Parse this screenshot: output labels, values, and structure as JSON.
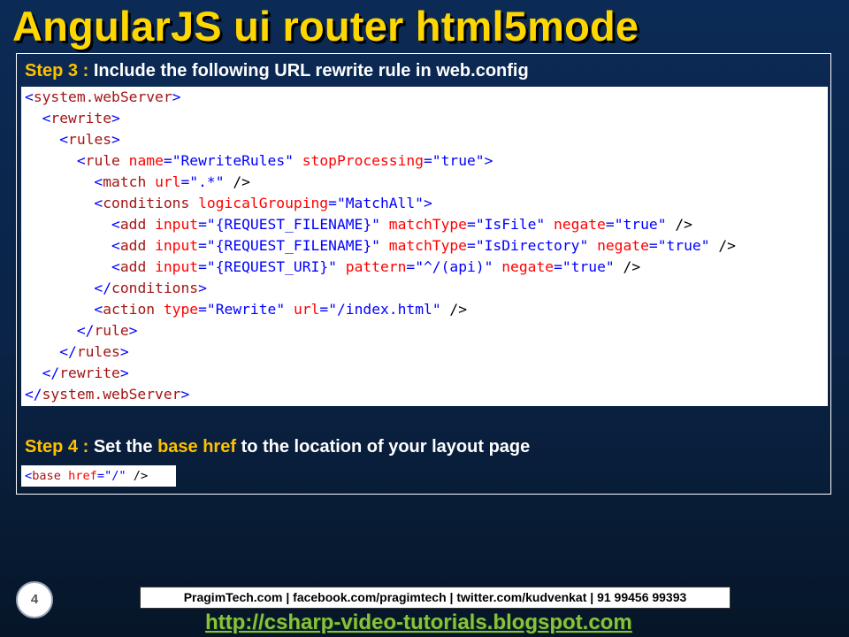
{
  "title": "AngularJS ui router html5mode",
  "step3": {
    "label": "Step 3 :",
    "text": "Include the following URL rewrite rule in web.config"
  },
  "code_lines": [
    "<system.webServer>",
    "  <rewrite>",
    "    <rules>",
    "      <rule name=\"RewriteRules\" stopProcessing=\"true\">",
    "        <match url=\".*\" />",
    "        <conditions logicalGrouping=\"MatchAll\">",
    "          <add input=\"{REQUEST_FILENAME}\" matchType=\"IsFile\" negate=\"true\" />",
    "          <add input=\"{REQUEST_FILENAME}\" matchType=\"IsDirectory\" negate=\"true\" />",
    "          <add input=\"{REQUEST_URI}\" pattern=\"^/(api)\" negate=\"true\" />",
    "        </conditions>",
    "        <action type=\"Rewrite\" url=\"/index.html\" />",
    "      </rule>",
    "    </rules>",
    "  </rewrite>",
    "</system.webServer>"
  ],
  "step4": {
    "label": "Step 4 :",
    "text_before": "Set the",
    "highlight": "base href",
    "text_after": "to the location of your layout page"
  },
  "base_code": "<base href=\"/\" />",
  "footer": {
    "page_number": "4",
    "contact": "PragimTech.com | facebook.com/pragimtech  | twitter.com/kudvenkat  | 91 99456 99393",
    "url": "http://csharp-video-tutorials.blogspot.com"
  },
  "colors": {
    "title": "#ffd700",
    "step_label": "#ffc000",
    "code_tag": "#a31515",
    "code_attr": "#ff0000",
    "code_value": "#0000ff",
    "link": "#8ac03c"
  }
}
